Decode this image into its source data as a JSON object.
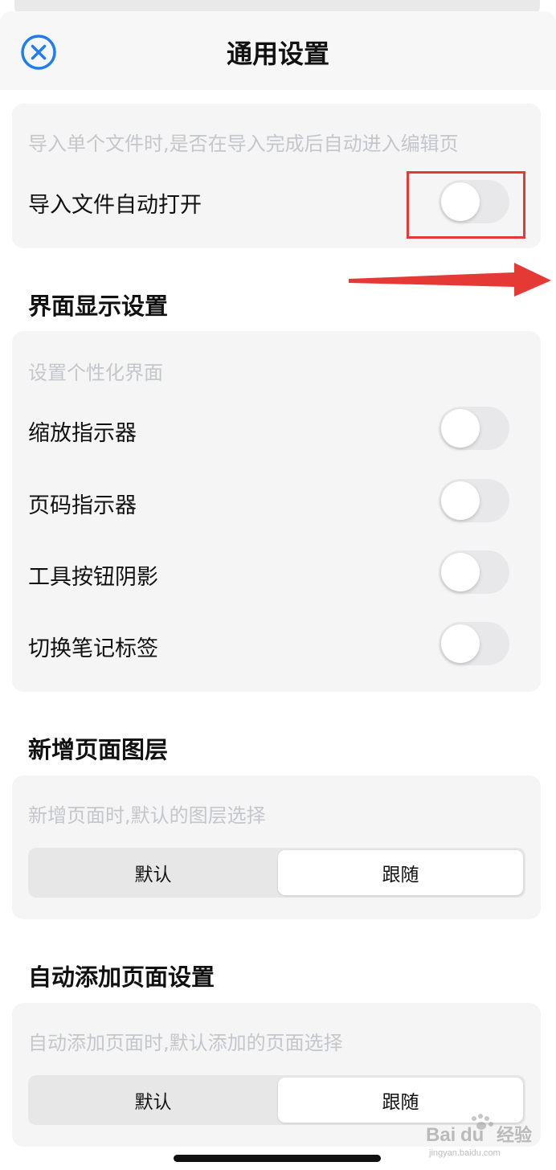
{
  "header": {
    "title": "通用设置",
    "close_icon": "close-circle-icon"
  },
  "import_card": {
    "hint": "导入单个文件时,是否在导入完成后自动进入编辑页",
    "row_label": "导入文件自动打开",
    "toggle_on": false
  },
  "display_section": {
    "title": "界面显示设置",
    "hint": "设置个性化界面",
    "rows": [
      {
        "label": "缩放指示器",
        "on": false
      },
      {
        "label": "页码指示器",
        "on": false
      },
      {
        "label": "工具按钮阴影",
        "on": false
      },
      {
        "label": "切换笔记标签",
        "on": false
      }
    ]
  },
  "new_page_layer": {
    "title": "新增页面图层",
    "hint": "新增页面时,默认的图层选择",
    "options": [
      "默认",
      "跟随"
    ],
    "selected": "跟随"
  },
  "auto_add_page": {
    "title": "自动添加页面设置",
    "hint": "自动添加页面时,默认添加的页面选择",
    "options": [
      "默认",
      "跟随"
    ],
    "selected": "跟随"
  },
  "annotations": {
    "highlight_color": "#e53935",
    "arrow_color": "#e53935"
  },
  "watermark": {
    "text": "Baidu经验",
    "subtext": "jingyan.baidu.com"
  },
  "colors": {
    "accent": "#1f7cf2",
    "toggle_off": "#e8e8ea",
    "card_bg": "#f5f5f6",
    "hint_text": "#c5c6cb"
  }
}
